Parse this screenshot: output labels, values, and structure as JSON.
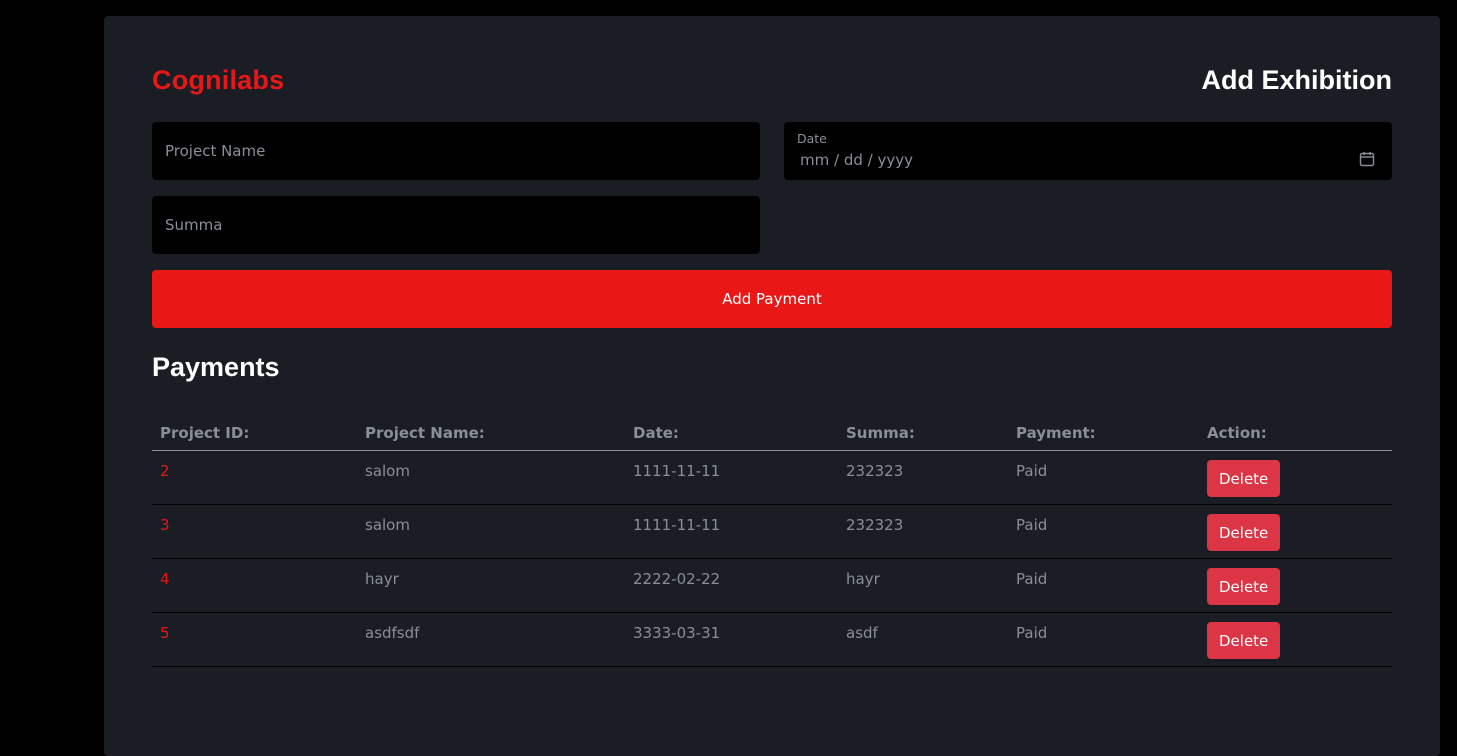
{
  "header": {
    "brand": "Cognilabs",
    "title": "Add Exhibition"
  },
  "form": {
    "project_name_placeholder": "Project Name",
    "summa_placeholder": "Summa",
    "date_label": "Date",
    "date_placeholder": "mm / dd / yyyy",
    "submit_label": "Add Payment"
  },
  "payments": {
    "title": "Payments",
    "columns": [
      "Project ID:",
      "Project Name:",
      "Date:",
      "Summa:",
      "Payment:",
      "Action:"
    ],
    "rows": [
      {
        "id": "2",
        "name": "salom",
        "date": "1111-11-11",
        "summa": "232323",
        "payment": "Paid",
        "action": "Delete"
      },
      {
        "id": "3",
        "name": "salom",
        "date": "1111-11-11",
        "summa": "232323",
        "payment": "Paid",
        "action": "Delete"
      },
      {
        "id": "4",
        "name": "hayr",
        "date": "2222-02-22",
        "summa": "hayr",
        "payment": "Paid",
        "action": "Delete"
      },
      {
        "id": "5",
        "name": "asdfsdf",
        "date": "3333-03-31",
        "summa": "asdf",
        "payment": "Paid",
        "action": "Delete"
      }
    ]
  },
  "icons": {
    "date_picker": "calendar-icon"
  },
  "colors": {
    "accent": "#e81717",
    "delete": "#dc3545",
    "card": "#1b1d25",
    "input_bg": "#000000"
  }
}
